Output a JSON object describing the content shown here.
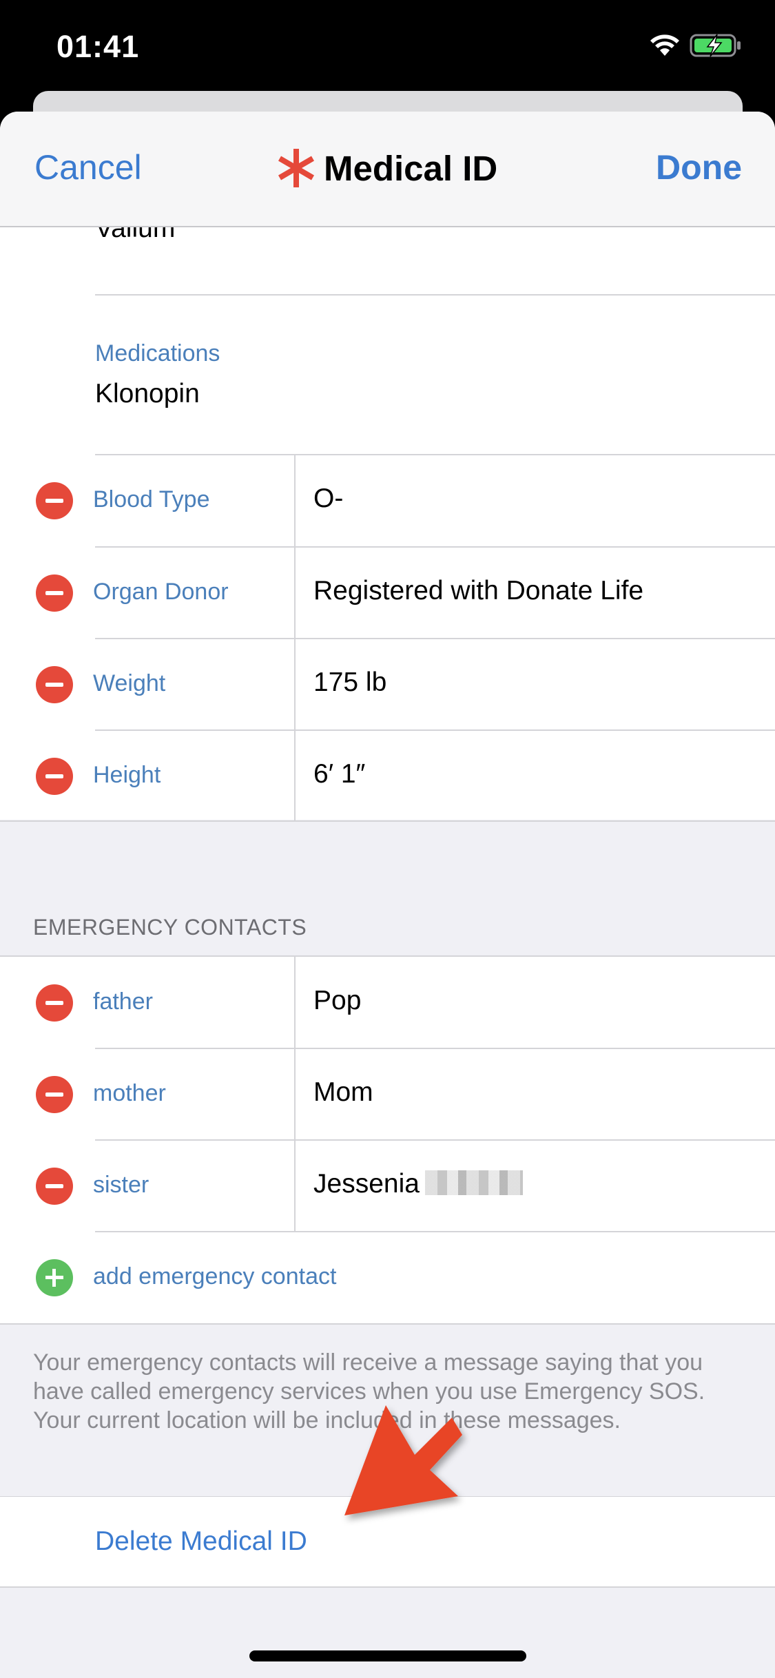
{
  "status_bar": {
    "time": "01:41",
    "icons": [
      "wifi-icon",
      "battery-charging-icon"
    ]
  },
  "nav": {
    "cancel_label": "Cancel",
    "title": "Medical ID",
    "title_icon": "medical-asterisk-icon",
    "done_label": "Done",
    "accent_color": "#3b7bd0",
    "asterisk_color": "#e5493a"
  },
  "allergies": {
    "value_partial": "Valium"
  },
  "medications": {
    "label": "Medications",
    "value": "Klonopin"
  },
  "fields": [
    {
      "label": "Blood Type",
      "value": "O-"
    },
    {
      "label": "Organ Donor",
      "value": "Registered with Donate Life"
    },
    {
      "label": "Weight",
      "value": "175 lb"
    },
    {
      "label": "Height",
      "value": "6′ 1″"
    }
  ],
  "emergency_contacts": {
    "header": "EMERGENCY CONTACTS",
    "contacts": [
      {
        "relation": "father",
        "name": "Pop"
      },
      {
        "relation": "mother",
        "name": "Mom"
      },
      {
        "relation": "sister",
        "name": "Jessenia"
      }
    ],
    "add_label": "add emergency contact",
    "footer": "Your emergency contacts will receive a message saying that you have called emergency services when you use Emergency SOS. Your current location will be included in these messages."
  },
  "delete_label": "Delete Medical ID",
  "annotation": {
    "type": "red-arrow",
    "color": "#e84427",
    "points_to": "Delete Medical ID"
  }
}
